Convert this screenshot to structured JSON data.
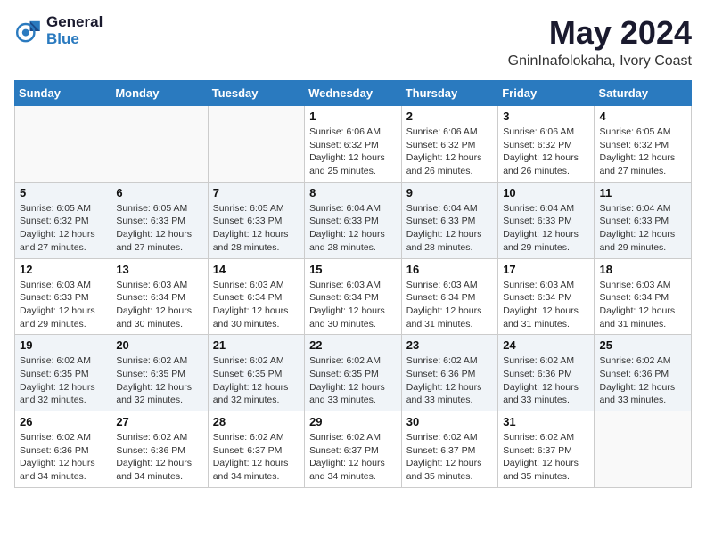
{
  "logo": {
    "line1": "General",
    "line2": "Blue"
  },
  "title": {
    "month_year": "May 2024",
    "location": "GninInafolokaha, Ivory Coast"
  },
  "weekdays": [
    "Sunday",
    "Monday",
    "Tuesday",
    "Wednesday",
    "Thursday",
    "Friday",
    "Saturday"
  ],
  "weeks": [
    [
      {
        "day": "",
        "info": ""
      },
      {
        "day": "",
        "info": ""
      },
      {
        "day": "",
        "info": ""
      },
      {
        "day": "1",
        "info": "Sunrise: 6:06 AM\nSunset: 6:32 PM\nDaylight: 12 hours\nand 25 minutes."
      },
      {
        "day": "2",
        "info": "Sunrise: 6:06 AM\nSunset: 6:32 PM\nDaylight: 12 hours\nand 26 minutes."
      },
      {
        "day": "3",
        "info": "Sunrise: 6:06 AM\nSunset: 6:32 PM\nDaylight: 12 hours\nand 26 minutes."
      },
      {
        "day": "4",
        "info": "Sunrise: 6:05 AM\nSunset: 6:32 PM\nDaylight: 12 hours\nand 27 minutes."
      }
    ],
    [
      {
        "day": "5",
        "info": "Sunrise: 6:05 AM\nSunset: 6:32 PM\nDaylight: 12 hours\nand 27 minutes."
      },
      {
        "day": "6",
        "info": "Sunrise: 6:05 AM\nSunset: 6:33 PM\nDaylight: 12 hours\nand 27 minutes."
      },
      {
        "day": "7",
        "info": "Sunrise: 6:05 AM\nSunset: 6:33 PM\nDaylight: 12 hours\nand 28 minutes."
      },
      {
        "day": "8",
        "info": "Sunrise: 6:04 AM\nSunset: 6:33 PM\nDaylight: 12 hours\nand 28 minutes."
      },
      {
        "day": "9",
        "info": "Sunrise: 6:04 AM\nSunset: 6:33 PM\nDaylight: 12 hours\nand 28 minutes."
      },
      {
        "day": "10",
        "info": "Sunrise: 6:04 AM\nSunset: 6:33 PM\nDaylight: 12 hours\nand 29 minutes."
      },
      {
        "day": "11",
        "info": "Sunrise: 6:04 AM\nSunset: 6:33 PM\nDaylight: 12 hours\nand 29 minutes."
      }
    ],
    [
      {
        "day": "12",
        "info": "Sunrise: 6:03 AM\nSunset: 6:33 PM\nDaylight: 12 hours\nand 29 minutes."
      },
      {
        "day": "13",
        "info": "Sunrise: 6:03 AM\nSunset: 6:34 PM\nDaylight: 12 hours\nand 30 minutes."
      },
      {
        "day": "14",
        "info": "Sunrise: 6:03 AM\nSunset: 6:34 PM\nDaylight: 12 hours\nand 30 minutes."
      },
      {
        "day": "15",
        "info": "Sunrise: 6:03 AM\nSunset: 6:34 PM\nDaylight: 12 hours\nand 30 minutes."
      },
      {
        "day": "16",
        "info": "Sunrise: 6:03 AM\nSunset: 6:34 PM\nDaylight: 12 hours\nand 31 minutes."
      },
      {
        "day": "17",
        "info": "Sunrise: 6:03 AM\nSunset: 6:34 PM\nDaylight: 12 hours\nand 31 minutes."
      },
      {
        "day": "18",
        "info": "Sunrise: 6:03 AM\nSunset: 6:34 PM\nDaylight: 12 hours\nand 31 minutes."
      }
    ],
    [
      {
        "day": "19",
        "info": "Sunrise: 6:02 AM\nSunset: 6:35 PM\nDaylight: 12 hours\nand 32 minutes."
      },
      {
        "day": "20",
        "info": "Sunrise: 6:02 AM\nSunset: 6:35 PM\nDaylight: 12 hours\nand 32 minutes."
      },
      {
        "day": "21",
        "info": "Sunrise: 6:02 AM\nSunset: 6:35 PM\nDaylight: 12 hours\nand 32 minutes."
      },
      {
        "day": "22",
        "info": "Sunrise: 6:02 AM\nSunset: 6:35 PM\nDaylight: 12 hours\nand 33 minutes."
      },
      {
        "day": "23",
        "info": "Sunrise: 6:02 AM\nSunset: 6:36 PM\nDaylight: 12 hours\nand 33 minutes."
      },
      {
        "day": "24",
        "info": "Sunrise: 6:02 AM\nSunset: 6:36 PM\nDaylight: 12 hours\nand 33 minutes."
      },
      {
        "day": "25",
        "info": "Sunrise: 6:02 AM\nSunset: 6:36 PM\nDaylight: 12 hours\nand 33 minutes."
      }
    ],
    [
      {
        "day": "26",
        "info": "Sunrise: 6:02 AM\nSunset: 6:36 PM\nDaylight: 12 hours\nand 34 minutes."
      },
      {
        "day": "27",
        "info": "Sunrise: 6:02 AM\nSunset: 6:36 PM\nDaylight: 12 hours\nand 34 minutes."
      },
      {
        "day": "28",
        "info": "Sunrise: 6:02 AM\nSunset: 6:37 PM\nDaylight: 12 hours\nand 34 minutes."
      },
      {
        "day": "29",
        "info": "Sunrise: 6:02 AM\nSunset: 6:37 PM\nDaylight: 12 hours\nand 34 minutes."
      },
      {
        "day": "30",
        "info": "Sunrise: 6:02 AM\nSunset: 6:37 PM\nDaylight: 12 hours\nand 35 minutes."
      },
      {
        "day": "31",
        "info": "Sunrise: 6:02 AM\nSunset: 6:37 PM\nDaylight: 12 hours\nand 35 minutes."
      },
      {
        "day": "",
        "info": ""
      }
    ]
  ]
}
